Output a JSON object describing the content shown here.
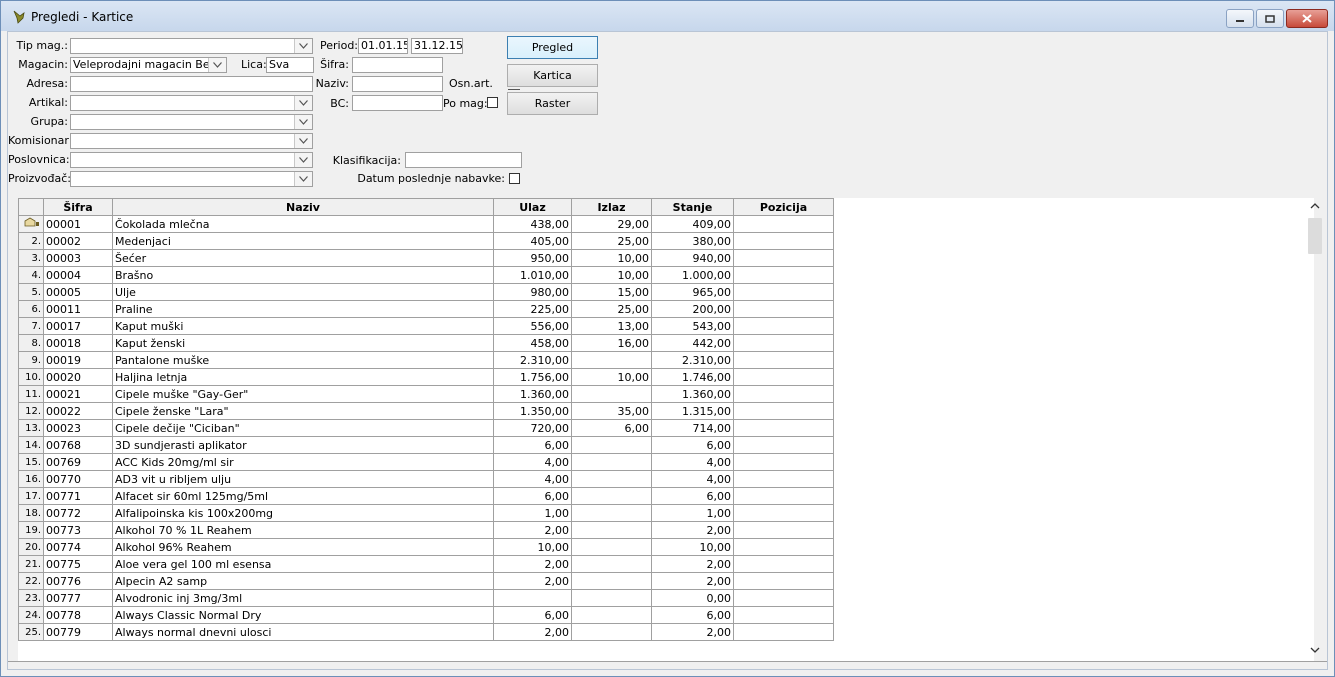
{
  "window": {
    "title": "Pregledi - Kartice"
  },
  "form": {
    "tip_mag_label": "Tip mag.:",
    "magacin_label": "Magacin:",
    "magacin_value": "Veleprodajni magacin Beogra",
    "lica_label": "Lica:",
    "lica_value": "Sva",
    "adresa_label": "Adresa:",
    "artikal_label": "Artikal:",
    "grupa_label": "Grupa:",
    "komisionar_label": "Komisionar:",
    "poslovnica_label": "Poslovnica:",
    "proizvodjac_label": "Proizvođač:",
    "period_label": "Period:",
    "period_from": "01.01.15",
    "period_to": "31.12.15",
    "sifra_label": "Šifra:",
    "naziv_label": "Naziv:",
    "osn_art_label": "Osn.art.",
    "bc_label": "BC:",
    "po_mag_label": "Po mag:",
    "klasifikacija_label": "Klasifikacija:",
    "datum_nabavke_label": "Datum poslednje nabavke:"
  },
  "buttons": {
    "pregled": "Pregled",
    "kartica": "Kartica",
    "raster": "Raster"
  },
  "grid": {
    "columns": [
      "Šifra",
      "Naziv",
      "Ulaz",
      "Izlaz",
      "Stanje",
      "Pozicija"
    ],
    "rows": [
      [
        "",
        "00001",
        "Čokolada mlečna",
        "438,00",
        "29,00",
        "409,00",
        ""
      ],
      [
        "2.",
        "00002",
        "Medenjaci",
        "405,00",
        "25,00",
        "380,00",
        ""
      ],
      [
        "3.",
        "00003",
        "Šećer",
        "950,00",
        "10,00",
        "940,00",
        ""
      ],
      [
        "4.",
        "00004",
        "Brašno",
        "1.010,00",
        "10,00",
        "1.000,00",
        ""
      ],
      [
        "5.",
        "00005",
        "Ulje",
        "980,00",
        "15,00",
        "965,00",
        ""
      ],
      [
        "6.",
        "00011",
        "Praline",
        "225,00",
        "25,00",
        "200,00",
        ""
      ],
      [
        "7.",
        "00017",
        "Kaput muški",
        "556,00",
        "13,00",
        "543,00",
        ""
      ],
      [
        "8.",
        "00018",
        "Kaput ženski",
        "458,00",
        "16,00",
        "442,00",
        ""
      ],
      [
        "9.",
        "00019",
        "Pantalone muške",
        "2.310,00",
        "",
        "2.310,00",
        ""
      ],
      [
        "10.",
        "00020",
        "Haljina letnja",
        "1.756,00",
        "10,00",
        "1.746,00",
        ""
      ],
      [
        "11.",
        "00021",
        "Cipele muške \"Gay-Ger\"",
        "1.360,00",
        "",
        "1.360,00",
        ""
      ],
      [
        "12.",
        "00022",
        "Cipele ženske \"Lara\"",
        "1.350,00",
        "35,00",
        "1.315,00",
        ""
      ],
      [
        "13.",
        "00023",
        "Cipele dečije \"Ciciban\"",
        "720,00",
        "6,00",
        "714,00",
        ""
      ],
      [
        "14.",
        "00768",
        "3D sundjerasti aplikator",
        "6,00",
        "",
        "6,00",
        ""
      ],
      [
        "15.",
        "00769",
        "ACC Kids 20mg/ml sir",
        "4,00",
        "",
        "4,00",
        ""
      ],
      [
        "16.",
        "00770",
        "AD3 vit u ribljem ulju",
        "4,00",
        "",
        "4,00",
        ""
      ],
      [
        "17.",
        "00771",
        "Alfacet sir 60ml 125mg/5ml",
        "6,00",
        "",
        "6,00",
        ""
      ],
      [
        "18.",
        "00772",
        "Alfalipoinska kis 100x200mg",
        "1,00",
        "",
        "1,00",
        ""
      ],
      [
        "19.",
        "00773",
        "Alkohol 70 %  1L Reahem",
        "2,00",
        "",
        "2,00",
        ""
      ],
      [
        "20.",
        "00774",
        "Alkohol 96% Reahem",
        "10,00",
        "",
        "10,00",
        ""
      ],
      [
        "21.",
        "00775",
        "Aloe vera gel 100 ml esensa",
        "2,00",
        "",
        "2,00",
        ""
      ],
      [
        "22.",
        "00776",
        "Alpecin A2 samp",
        "2,00",
        "",
        "2,00",
        ""
      ],
      [
        "23.",
        "00777",
        "Alvodronic inj 3mg/3ml",
        "",
        "",
        "0,00",
        ""
      ],
      [
        "24.",
        "00778",
        "Always Classic Normal Dry",
        "6,00",
        "",
        "6,00",
        ""
      ],
      [
        "25.",
        "00779",
        "Always normal dnevni ulosci",
        "2,00",
        "",
        "2,00",
        ""
      ]
    ]
  }
}
